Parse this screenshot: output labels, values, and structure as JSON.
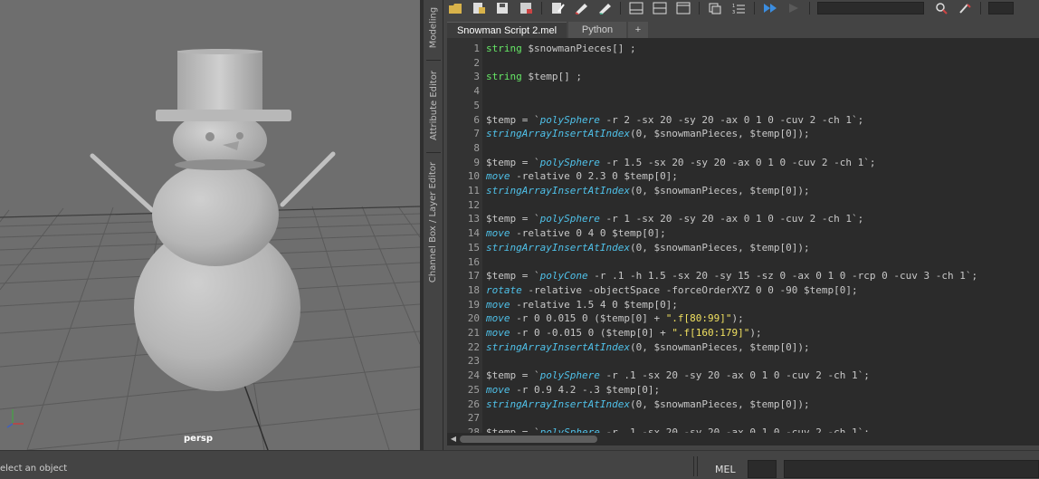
{
  "viewport": {
    "camera_label": "persp",
    "axis_y": "y",
    "axis_x": "x"
  },
  "side_tabs": [
    "Modeling",
    "Attribute Editor",
    "Channel Box / Layer Editor"
  ],
  "toolbar": {
    "icons": [
      "open-script-icon",
      "source-script-icon",
      "save-script-icon",
      "save-to-shelf-icon",
      "clear-history-icon",
      "clear-input-icon",
      "clear-all-icon",
      "layout-a-icon",
      "layout-b-icon",
      "layout-c-icon",
      "echo-all-icon",
      "line-numbers-icon",
      "execute-all-icon",
      "execute-icon",
      "search-icon",
      "settings-icon"
    ]
  },
  "script_tabs": [
    {
      "label": "Snowman Script 2.mel",
      "active": true
    },
    {
      "label": "Python",
      "active": false
    },
    {
      "label": "+",
      "active": false
    }
  ],
  "editor": {
    "lines": [
      {
        "n": "1",
        "parts": [
          [
            "kw",
            "string"
          ],
          [
            "",
            " $snowmanPieces[] ;"
          ]
        ]
      },
      {
        "n": "2",
        "parts": []
      },
      {
        "n": "3",
        "parts": [
          [
            "kw",
            "string"
          ],
          [
            "",
            " $temp[] ;"
          ]
        ]
      },
      {
        "n": "4",
        "parts": []
      },
      {
        "n": "5",
        "parts": []
      },
      {
        "n": "6",
        "parts": [
          [
            "",
            "$temp = `"
          ],
          [
            "fn",
            "polySphere"
          ],
          [
            "",
            " -r 2 -sx 20 -sy 20 -ax 0 1 0 -cuv 2 -ch 1`;"
          ]
        ]
      },
      {
        "n": "7",
        "parts": [
          [
            "fn",
            "stringArrayInsertAtIndex"
          ],
          [
            "",
            "(0, $snowmanPieces, $temp[0]);"
          ]
        ]
      },
      {
        "n": "8",
        "parts": []
      },
      {
        "n": "9",
        "parts": [
          [
            "",
            "$temp = `"
          ],
          [
            "fn",
            "polySphere"
          ],
          [
            "",
            " -r 1.5 -sx 20 -sy 20 -ax 0 1 0 -cuv 2 -ch 1`;"
          ]
        ]
      },
      {
        "n": "10",
        "parts": [
          [
            "fn",
            "move"
          ],
          [
            "",
            " -relative 0 2.3 0 $temp[0];"
          ]
        ]
      },
      {
        "n": "11",
        "parts": [
          [
            "fn",
            "stringArrayInsertAtIndex"
          ],
          [
            "",
            "(0, $snowmanPieces, $temp[0]);"
          ]
        ]
      },
      {
        "n": "12",
        "parts": []
      },
      {
        "n": "13",
        "parts": [
          [
            "",
            "$temp = `"
          ],
          [
            "fn",
            "polySphere"
          ],
          [
            "",
            " -r 1 -sx 20 -sy 20 -ax 0 1 0 -cuv 2 -ch 1`;"
          ]
        ]
      },
      {
        "n": "14",
        "parts": [
          [
            "fn",
            "move"
          ],
          [
            "",
            " -relative 0 4 0 $temp[0];"
          ]
        ]
      },
      {
        "n": "15",
        "parts": [
          [
            "fn",
            "stringArrayInsertAtIndex"
          ],
          [
            "",
            "(0, $snowmanPieces, $temp[0]);"
          ]
        ]
      },
      {
        "n": "16",
        "parts": []
      },
      {
        "n": "17",
        "parts": [
          [
            "",
            "$temp = `"
          ],
          [
            "fn",
            "polyCone"
          ],
          [
            "",
            " -r .1 -h 1.5 -sx 20 -sy 15 -sz 0 -ax 0 1 0 -rcp 0 -cuv 3 -ch 1`;"
          ]
        ]
      },
      {
        "n": "18",
        "parts": [
          [
            "fn",
            "rotate"
          ],
          [
            "",
            " -relative -objectSpace -forceOrderXYZ 0 0 -90 $temp[0];"
          ]
        ]
      },
      {
        "n": "19",
        "parts": [
          [
            "fn",
            "move"
          ],
          [
            "",
            " -relative 1.5 4 0 $temp[0];"
          ]
        ]
      },
      {
        "n": "20",
        "parts": [
          [
            "fn",
            "move"
          ],
          [
            "",
            " -r 0 0.015 0 ($temp[0] + "
          ],
          [
            "str",
            "\".f[80:99]\""
          ],
          [
            "",
            ");"
          ]
        ]
      },
      {
        "n": "21",
        "parts": [
          [
            "fn",
            "move"
          ],
          [
            "",
            " -r 0 -0.015 0 ($temp[0] + "
          ],
          [
            "str",
            "\".f[160:179]\""
          ],
          [
            "",
            ");"
          ]
        ]
      },
      {
        "n": "22",
        "parts": [
          [
            "fn",
            "stringArrayInsertAtIndex"
          ],
          [
            "",
            "(0, $snowmanPieces, $temp[0]);"
          ]
        ]
      },
      {
        "n": "23",
        "parts": []
      },
      {
        "n": "24",
        "parts": [
          [
            "",
            "$temp = `"
          ],
          [
            "fn",
            "polySphere"
          ],
          [
            "",
            " -r .1 -sx 20 -sy 20 -ax 0 1 0 -cuv 2 -ch 1`;"
          ]
        ]
      },
      {
        "n": "25",
        "parts": [
          [
            "fn",
            "move"
          ],
          [
            "",
            " -r 0.9 4.2 -.3 $temp[0];"
          ]
        ]
      },
      {
        "n": "26",
        "parts": [
          [
            "fn",
            "stringArrayInsertAtIndex"
          ],
          [
            "",
            "(0, $snowmanPieces, $temp[0]);"
          ]
        ]
      },
      {
        "n": "27",
        "parts": []
      },
      {
        "n": "28",
        "parts": [
          [
            "",
            "$temp = `"
          ],
          [
            "fn",
            "polySphere"
          ],
          [
            "",
            " -r .1 -sx 20 -sy 20 -ax 0 1 0 -cuv 2 -ch 1`;"
          ]
        ]
      }
    ]
  },
  "statusbar": {
    "message": "elect an object",
    "mel_label": "MEL"
  },
  "colors": {
    "keyword": "#66e866",
    "function": "#4fc1e9",
    "string": "#f0e060",
    "viewport_bg": "#6e6e6e",
    "editor_bg": "#2b2b2b"
  }
}
